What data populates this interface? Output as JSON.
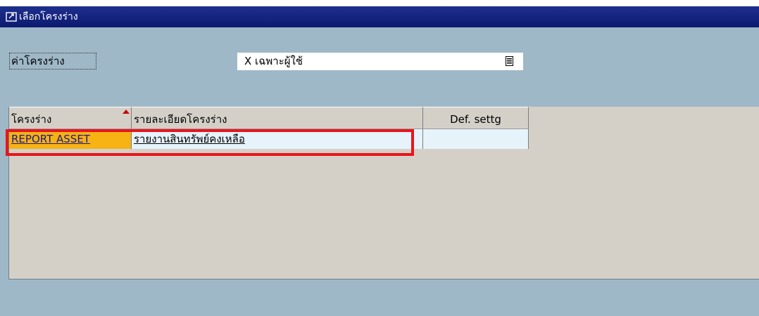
{
  "window": {
    "title": "เลือกโครงร่าง"
  },
  "field": {
    "label": "ค่าโครงร่าง",
    "value": "X เฉพาะผู้ใช้"
  },
  "table": {
    "columns": [
      "โครงร่าง",
      "รายละเอียดโครงร่าง",
      "Def. settg"
    ],
    "rows": [
      {
        "layout": "REPORT ASSET",
        "description": "รายงานสินทรัพย์คงเหลือ",
        "default_setting": ""
      }
    ]
  },
  "colors": {
    "title_bar": "#0c1a6f",
    "background": "#9fb8c8",
    "selected_cell": "#f7b214",
    "highlight": "#e8151b"
  },
  "icons": [
    "window-icon",
    "value-list-icon",
    "sort-ascending-icon"
  ]
}
